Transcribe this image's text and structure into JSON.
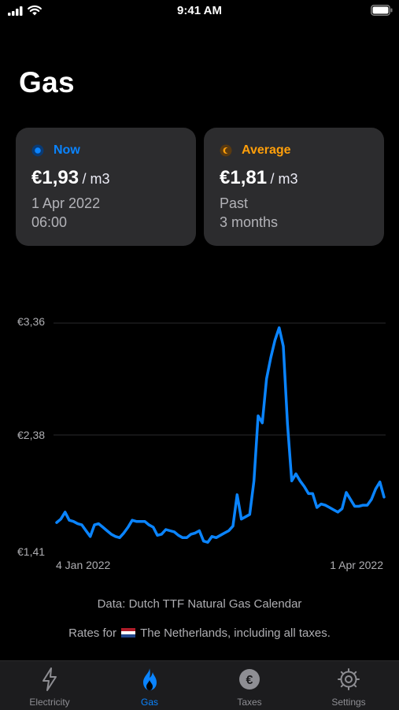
{
  "status_bar": {
    "time": "9:41 AM"
  },
  "page_title": "Gas",
  "cards": {
    "now": {
      "label": "Now",
      "label_color": "#0a84ff",
      "icon": "now-dot-icon",
      "value": "€1,93",
      "unit": "/ m3",
      "sub1": "1 Apr 2022",
      "sub2": "06:00"
    },
    "average": {
      "label": "Average",
      "label_color": "#ff9f0a",
      "icon": "average-coin-icon",
      "value": "€1,81",
      "unit": "/ m3",
      "sub1": "Past",
      "sub2": "3 months"
    }
  },
  "chart_data": {
    "type": "line",
    "title": "",
    "xlabel": "",
    "ylabel": "",
    "x_start_label": "4 Jan 2022",
    "x_end_label": "1 Apr 2022",
    "y_tick_labels": [
      "€3,36",
      "€2,38",
      "€1,41"
    ],
    "y_ticks": [
      3.36,
      2.38,
      1.41
    ],
    "ylim": [
      1.41,
      3.36
    ],
    "grid": true,
    "line_color": "#0a84ff",
    "series": [
      {
        "values": [
          1.64,
          1.67,
          1.73,
          1.66,
          1.65,
          1.63,
          1.62,
          1.57,
          1.52,
          1.62,
          1.63,
          1.6,
          1.57,
          1.54,
          1.52,
          1.51,
          1.55,
          1.6,
          1.66,
          1.65,
          1.65,
          1.65,
          1.62,
          1.6,
          1.53,
          1.54,
          1.58,
          1.57,
          1.56,
          1.53,
          1.51,
          1.51,
          1.54,
          1.55,
          1.57,
          1.48,
          1.47,
          1.52,
          1.51,
          1.53,
          1.55,
          1.57,
          1.61,
          1.88,
          1.67,
          1.69,
          1.71,
          2.0,
          2.56,
          2.5,
          2.88,
          3.06,
          3.21,
          3.32,
          3.16,
          2.49,
          2.0,
          2.06,
          2.0,
          1.95,
          1.89,
          1.89,
          1.77,
          1.8,
          1.79,
          1.77,
          1.75,
          1.73,
          1.76,
          1.9,
          1.84,
          1.78,
          1.78,
          1.79,
          1.79,
          1.84,
          1.93,
          1.99,
          1.86
        ]
      }
    ]
  },
  "footer": {
    "source": "Data: Dutch TTF Natural Gas Calendar",
    "rates_prefix": "Rates for",
    "rates_suffix": "The Netherlands, including all taxes."
  },
  "tabs": [
    {
      "label": "Electricity",
      "icon": "lightning-icon",
      "active": false
    },
    {
      "label": "Gas",
      "icon": "flame-icon",
      "active": true
    },
    {
      "label": "Taxes",
      "icon": "euro-coin-icon",
      "active": false
    },
    {
      "label": "Settings",
      "icon": "gear-icon",
      "active": false
    }
  ],
  "colors": {
    "accent": "#0a84ff",
    "average": "#ff9f0a",
    "card_bg": "#2c2c2e",
    "background": "#000000"
  }
}
